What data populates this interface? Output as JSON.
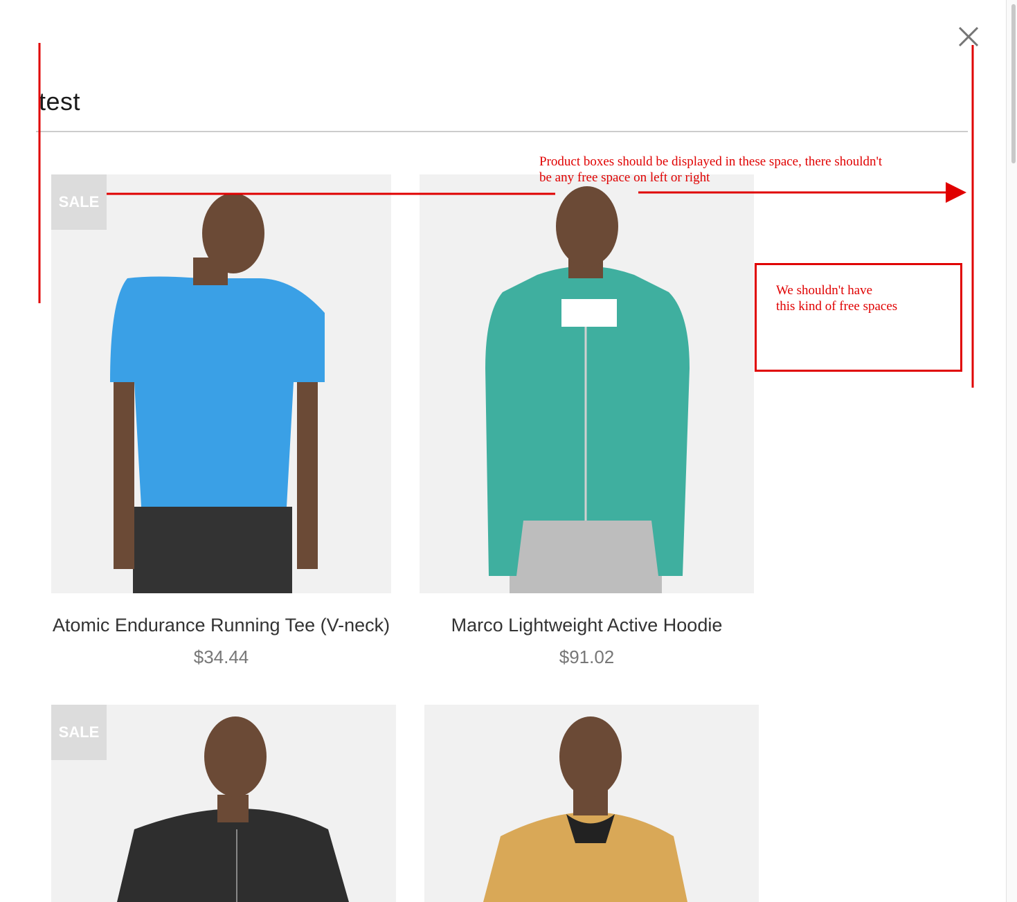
{
  "modal": {
    "title": "test",
    "close_icon": "close-icon"
  },
  "products": [
    {
      "name": "Atomic Endurance Running Tee (V-neck)",
      "price": "$34.44",
      "badge": "SALE",
      "shirt_color": "#3aa0e6"
    },
    {
      "name": "Marco Lightweight Active Hoodie",
      "price": "$91.02",
      "badge": "",
      "shirt_color": "#3faf9f"
    },
    {
      "name": "",
      "price": "",
      "badge": "SALE",
      "shirt_color": "#2e2e2e"
    },
    {
      "name": "",
      "price": "",
      "badge": "",
      "shirt_color": "#d9a857"
    }
  ],
  "annotations": {
    "top_note_line1": "Product boxes should be displayed in these space, there shouldn't",
    "top_note_line2": "be any free space on left or right",
    "box_note_line1": "We shouldn't have",
    "box_note_line2": "this kind of free spaces",
    "color": "#e00000"
  }
}
